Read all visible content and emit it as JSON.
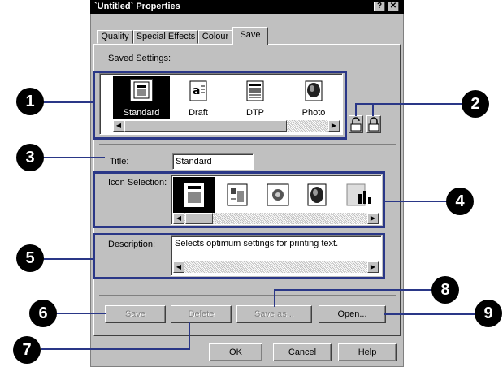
{
  "window": {
    "title": "`Untitled` Properties",
    "help_btn": "?",
    "close_btn": "✕"
  },
  "tabs": [
    "Quality",
    "Special Effects",
    "Colour",
    "Save"
  ],
  "saved_settings": {
    "label": "Saved Settings:",
    "items": [
      {
        "label": "Standard",
        "icon": "standard-document-icon",
        "selected": true
      },
      {
        "label": "Draft",
        "icon": "draft-document-icon",
        "selected": false
      },
      {
        "label": "DTP",
        "icon": "dtp-document-icon",
        "selected": false
      },
      {
        "label": "Photo",
        "icon": "photo-document-icon",
        "selected": false
      }
    ]
  },
  "title_field": {
    "label": "Title:",
    "value": "Standard"
  },
  "icon_selection": {
    "label": "Icon Selection:",
    "icons": [
      "standard-document-icon",
      "chart-document-icon",
      "flower-document-icon",
      "photo-document-icon",
      "bar-chart-document-icon"
    ]
  },
  "description": {
    "label": "Description:",
    "value": "Selects optimum settings for printing text."
  },
  "buttons": {
    "save": "Save",
    "delete": "Delete",
    "save_as": "Save as...",
    "open": "Open..."
  },
  "footer": {
    "ok": "OK",
    "cancel": "Cancel",
    "help": "Help"
  },
  "callouts": [
    "1",
    "2",
    "3",
    "4",
    "5",
    "6",
    "7",
    "8",
    "9"
  ],
  "colors": {
    "highlight": "#2a3787",
    "dialog": "#c0c0c0"
  }
}
